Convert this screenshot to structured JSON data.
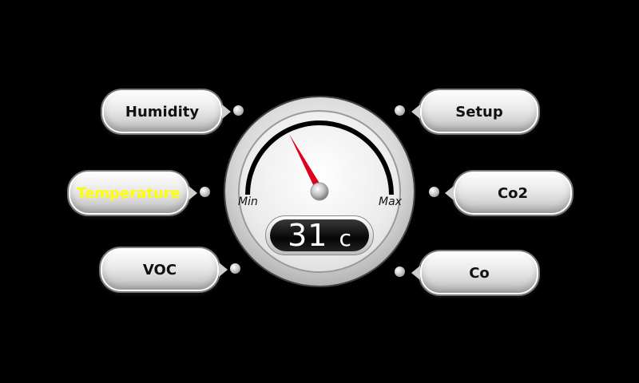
{
  "buttons": {
    "humidity": "Humidity",
    "temperature": "Temperature",
    "voc": "VOC",
    "setup": "Setup",
    "co2": "Co2",
    "co": "Co"
  },
  "active_button": "Temperature",
  "gauge": {
    "min_label": "Min",
    "max_label": "Max",
    "value": "31",
    "unit": "c",
    "needle_color": "#e0001b"
  },
  "colors": {
    "background": "#000000",
    "active_text": "#ffff00"
  }
}
